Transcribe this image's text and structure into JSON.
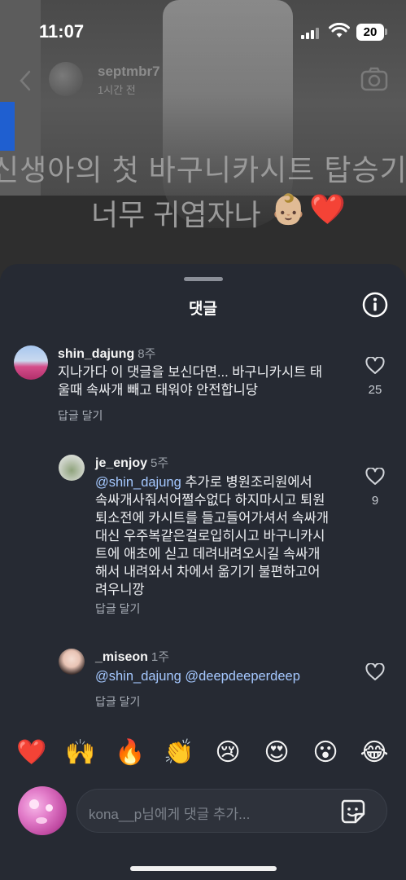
{
  "status_bar": {
    "time": "11:07",
    "battery": "20"
  },
  "story": {
    "username": "septmbr7",
    "posted": "1시간 전",
    "caption_line1": "신생아의 첫 바구니카시트 탑승기",
    "caption_line2": "너무 귀엽자나",
    "caption_emojis": [
      "👶🏼",
      "❤️"
    ]
  },
  "sheet": {
    "title": "댓글",
    "comments": [
      {
        "username": "shin_dajung",
        "time": "8주",
        "text_lines": [
          "지나가다 이 댓글을 보신다면... 바구니카시트 태",
          "울때 속싸개 빼고 태워야 안전합니당"
        ],
        "reply_label": "답글 달기",
        "likes": "25"
      },
      {
        "username": "je_enjoy",
        "time": "5주",
        "mention": "@shin_dajung",
        "text_first": " 추가로 병원조리원에서",
        "text_lines": [
          "속싸개사줘서어쩔수없다 하지마시고 퇴원",
          "퇴소전에 카시트를 들고들어가셔서 속싸개",
          "대신 우주복같은걸로입히시고 바구니카시",
          "트에 애초에 싣고 데려내려오시길 속싸개",
          "해서 내려와서 차에서 옮기기 불편하고어",
          "려우니깡"
        ],
        "reply_label": "답글 달기",
        "likes": "9"
      },
      {
        "username": "_miseon",
        "time": "1주",
        "mention1": "@shin_dajung",
        "mention2": "@deepdeeperdeep",
        "reply_label": "답글 달기"
      }
    ]
  },
  "emoji_bar": [
    "❤️",
    "🙌",
    "🔥",
    "👏",
    "😢",
    "😍",
    "😮",
    "😂"
  ],
  "input": {
    "placeholder": "kona__p님에게 댓글 추가..."
  },
  "colors": {
    "sheet_bg": "#262a33",
    "mention": "#a5c8ff",
    "secondary_text": "#9aa0a8"
  }
}
